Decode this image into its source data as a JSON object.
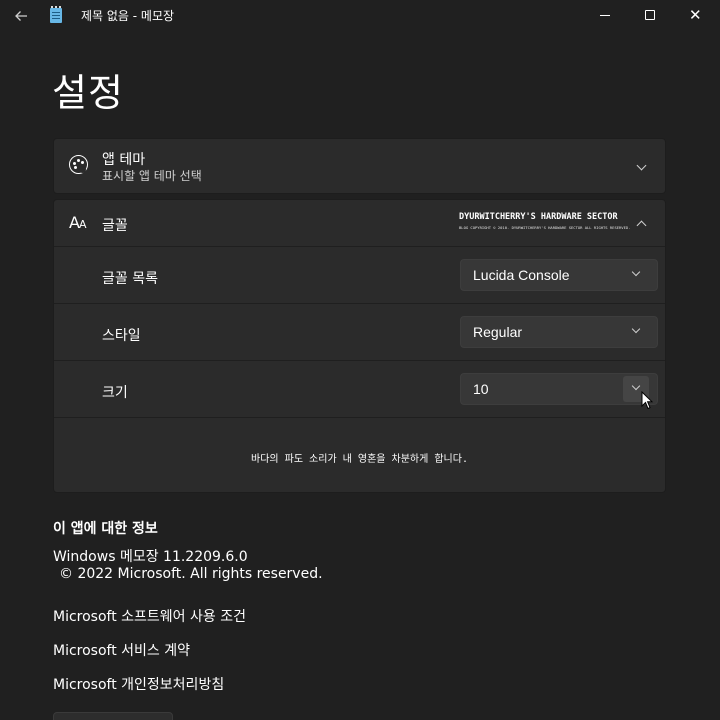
{
  "window": {
    "title": "제목 없음 - 메모장",
    "back_icon": "back-arrow-icon",
    "app_icon": "notepad-icon"
  },
  "page": {
    "title": "설정"
  },
  "theme_card": {
    "icon": "palette-icon",
    "title": "앱 테마",
    "subtitle": "표시할 앱 테마 선택"
  },
  "font_card": {
    "icon": "font-size-icon",
    "title": "글꼴",
    "watermark_main": "DYURWITCHERRY'S HARDWARE SECTOR",
    "watermark_sub": "BLOG COPYRIGHT © 2010. DYURWITCHERRY'S HARDWARE SECTOR ALL RIGHTS RESERVED.",
    "rows": [
      {
        "label": "글꼴 목록",
        "value": "Lucida Console"
      },
      {
        "label": "스타일",
        "value": "Regular"
      },
      {
        "label": "크기",
        "value": "10"
      }
    ],
    "preview_text": "바다의 파도 소리가 내 영혼을 차분하게 합니다."
  },
  "about": {
    "heading": "이 앱에 대한 정보",
    "version": "Windows 메모장 11.2209.6.0",
    "copyright": "© 2022 Microsoft. All rights reserved.",
    "links": [
      "Microsoft 소프트웨어 사용 조건",
      "Microsoft 서비스 계약",
      "Microsoft 개인정보처리방침"
    ]
  },
  "colors": {
    "background": "#202020",
    "card": "#2b2b2b",
    "dropdown": "#373737",
    "text": "#ffffff"
  }
}
